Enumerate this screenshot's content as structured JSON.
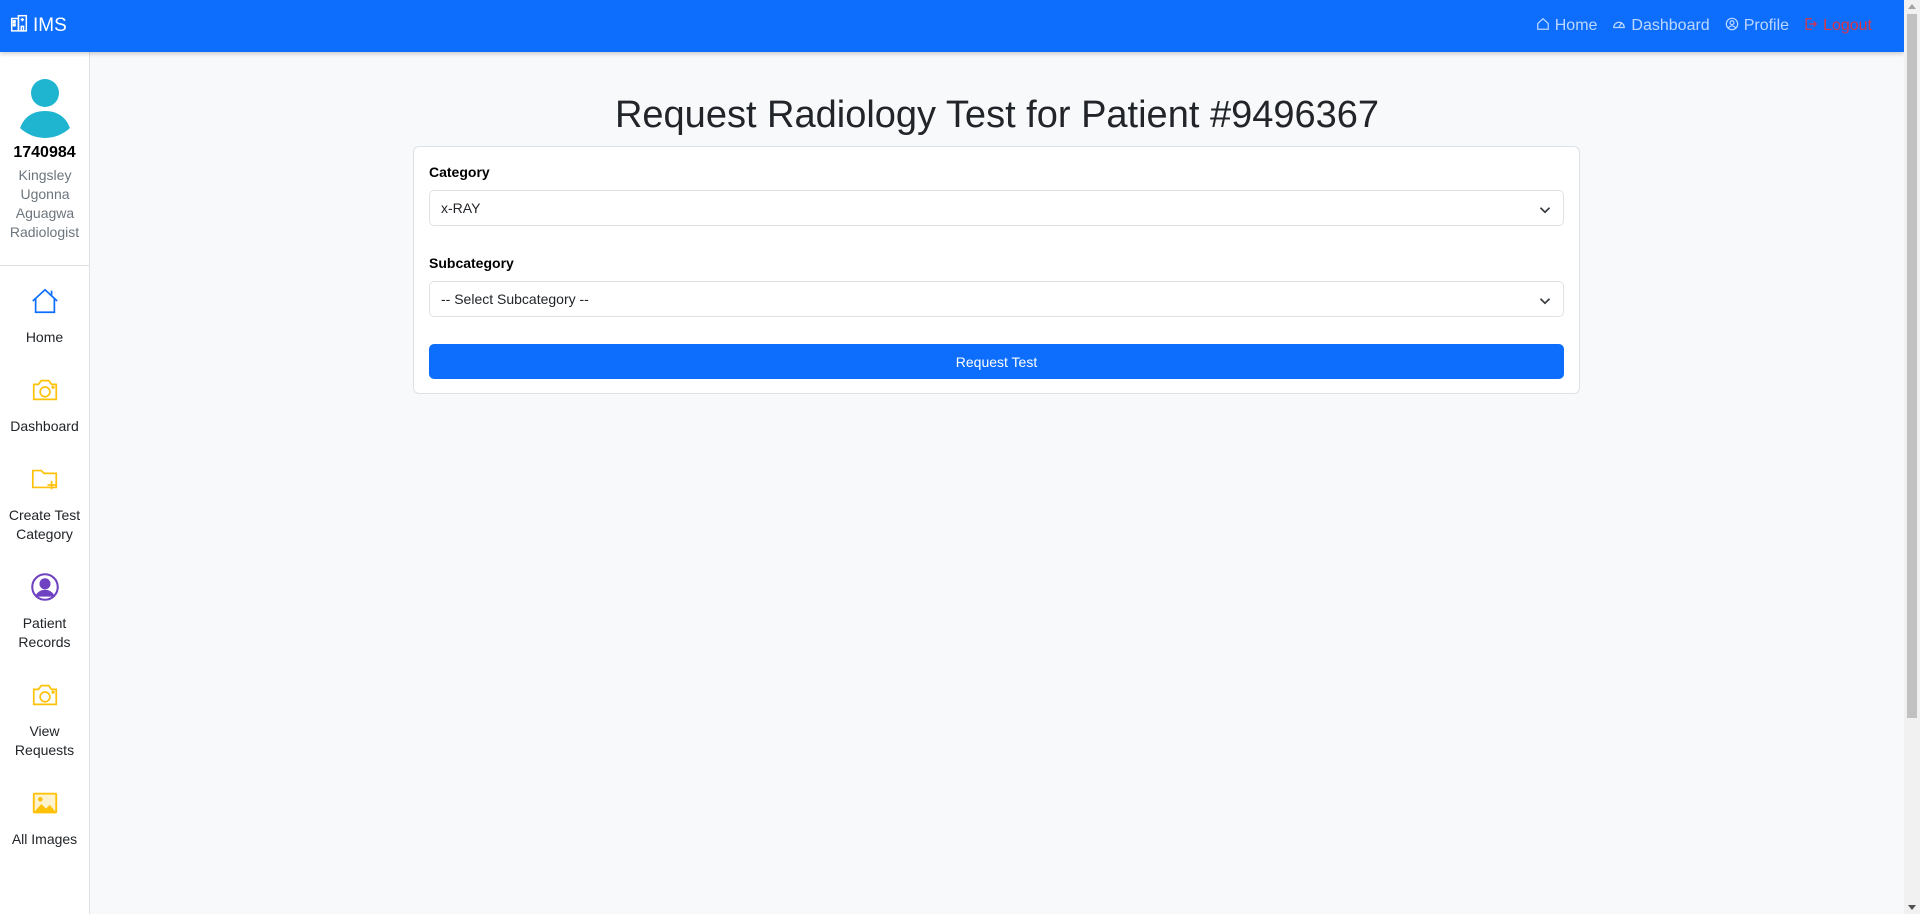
{
  "navbar": {
    "brand": "IMS",
    "links": [
      {
        "label": "Home",
        "icon": "house-icon"
      },
      {
        "label": "Dashboard",
        "icon": "speedometer-icon"
      },
      {
        "label": "Profile",
        "icon": "person-circle-icon"
      },
      {
        "label": "Logout",
        "icon": "logout-icon"
      }
    ]
  },
  "user": {
    "id": "1740984",
    "name": "Kingsley Ugonna Aguagwa",
    "role": "Radiologist"
  },
  "sidebar": {
    "items": [
      {
        "label": "Home",
        "icon": "house-icon"
      },
      {
        "label": "Dashboard",
        "icon": "camera-icon"
      },
      {
        "label": "Create Test Category",
        "icon": "folder-plus-icon"
      },
      {
        "label": "Patient Records",
        "icon": "person-circle-icon"
      },
      {
        "label": "View Requests",
        "icon": "camera-icon"
      },
      {
        "label": "All Images",
        "icon": "image-icon"
      }
    ]
  },
  "page": {
    "title": "Request Radiology Test for Patient #9496367"
  },
  "form": {
    "category_label": "Category",
    "category_value": "x-RAY",
    "subcategory_label": "Subcategory",
    "subcategory_value": "-- Select Subcategory --",
    "submit_label": "Request Test"
  },
  "colors": {
    "primary": "#0d6efd",
    "danger": "#dc3545",
    "warning_icon": "#ffc107",
    "avatar": "#1fb5d0",
    "purple_icon": "#6f42c1"
  }
}
